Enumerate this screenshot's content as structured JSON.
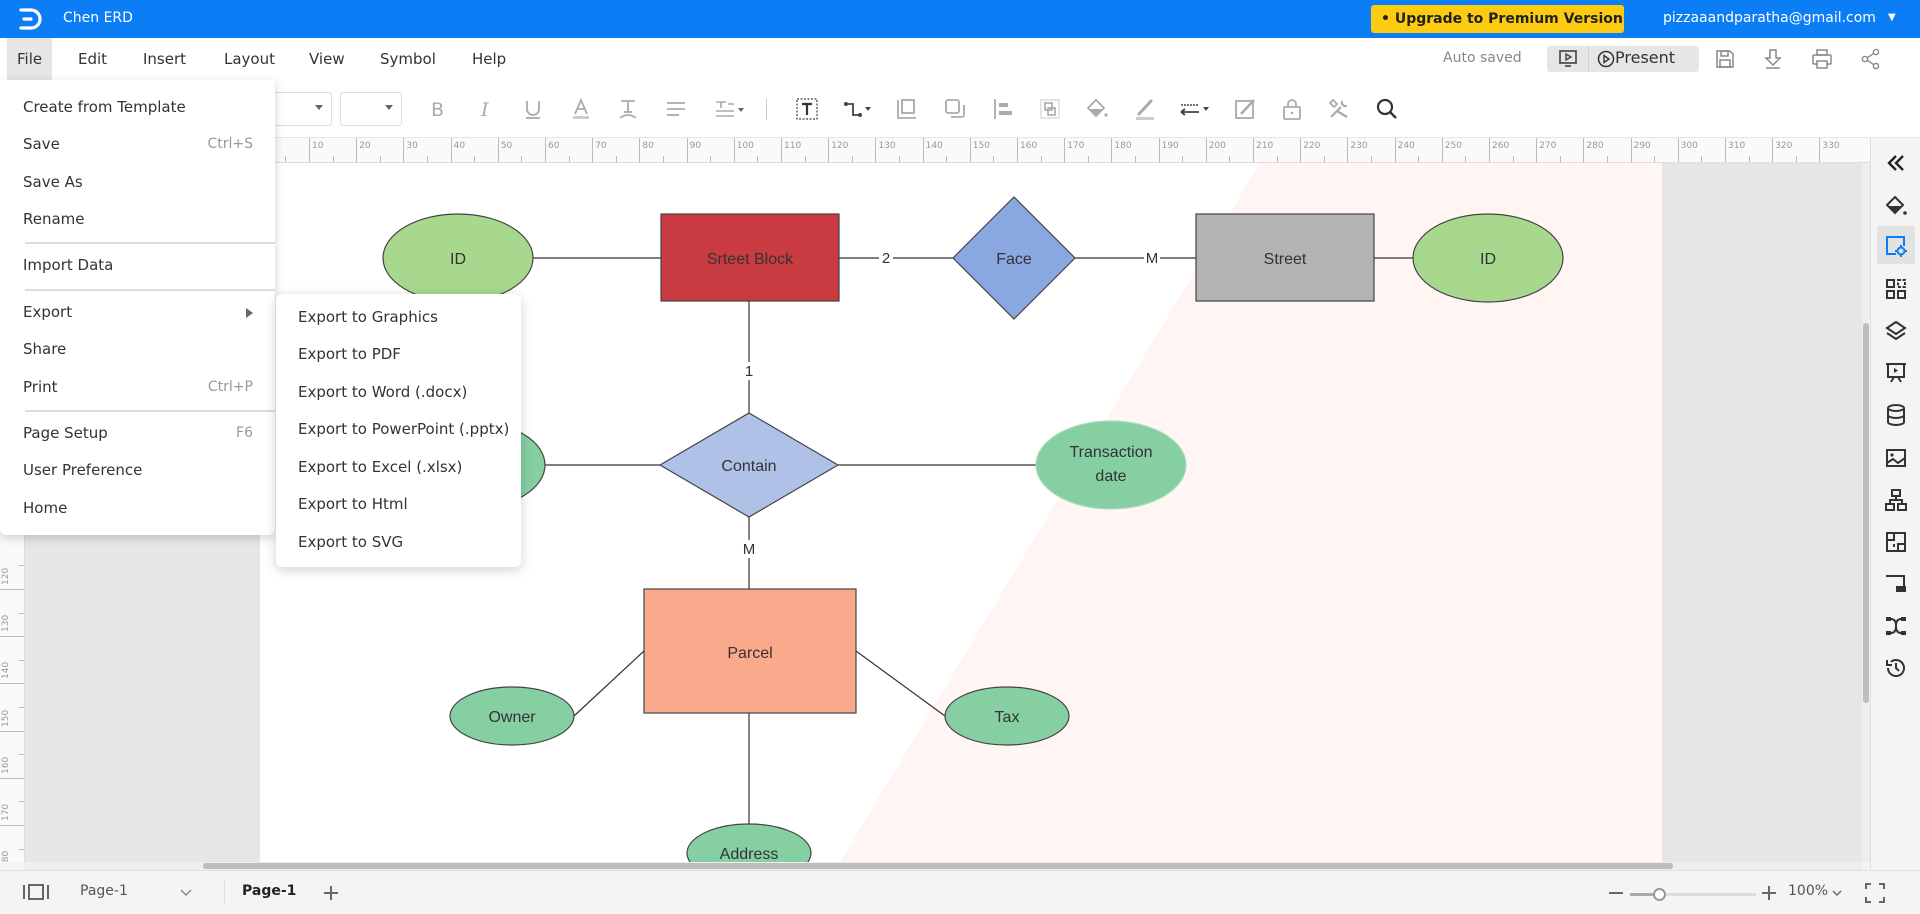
{
  "app": {
    "title": "Chen ERD",
    "upgrade_label": "• Upgrade to Premium Version",
    "user_email": "pizzaaandparatha@gmail.com"
  },
  "menubar": {
    "items": [
      "File",
      "Edit",
      "Insert",
      "Layout",
      "View",
      "Symbol",
      "Help"
    ],
    "active": "File",
    "status": "Auto saved",
    "present_label": "Present"
  },
  "toolbar": {
    "font_family_value": "",
    "font_size_value": "",
    "icons": [
      "bold-icon",
      "italic-icon",
      "underline-icon",
      "font-color-icon",
      "text-style-icon",
      "align-icon",
      "spacing-icon",
      "text-box-icon",
      "connector-icon",
      "container-icon",
      "arrange-icon",
      "align-shapes-icon",
      "group-icon",
      "fill-icon",
      "line-color-icon",
      "line-style-icon",
      "edit-image-icon",
      "lock-icon",
      "tools-icon",
      "search-icon"
    ]
  },
  "ruler": {
    "horizontal": [
      "10",
      "20",
      "30",
      "40",
      "50",
      "60",
      "70",
      "80",
      "90",
      "100",
      "110",
      "120",
      "130",
      "140",
      "150",
      "160",
      "170",
      "180",
      "190",
      "200",
      "210",
      "220",
      "230",
      "240",
      "250",
      "260",
      "270",
      "280",
      "290",
      "300",
      "310",
      "320",
      "330"
    ],
    "vertical": [
      "120",
      "130",
      "140",
      "150",
      "160",
      "170",
      "180"
    ]
  },
  "file_menu": {
    "items": [
      {
        "label": "Create from Template",
        "shortcut": ""
      },
      {
        "label": "Save",
        "shortcut": "Ctrl+S"
      },
      {
        "label": "Save As",
        "shortcut": ""
      },
      {
        "label": "Rename",
        "shortcut": ""
      },
      {
        "label": "Import Data",
        "shortcut": ""
      },
      {
        "label": "Export",
        "shortcut": "",
        "submenu": true
      },
      {
        "label": "Share",
        "shortcut": ""
      },
      {
        "label": "Print",
        "shortcut": "Ctrl+P"
      },
      {
        "label": "Page Setup",
        "shortcut": "F6"
      },
      {
        "label": "User Preference",
        "shortcut": ""
      },
      {
        "label": "Home",
        "shortcut": ""
      }
    ]
  },
  "export_menu": {
    "items": [
      "Export to Graphics",
      "Export to PDF",
      "Export to Word (.docx)",
      "Export to PowerPoint (.pptx)",
      "Export to Excel (.xlsx)",
      "Export to Html",
      "Export to SVG"
    ]
  },
  "diagram": {
    "entities": [
      {
        "id": "street-block",
        "label": "Srteet Block",
        "color": "#c93b40"
      },
      {
        "id": "street",
        "label": "Street",
        "color": "#b3b3b3"
      },
      {
        "id": "parcel",
        "label": "Parcel",
        "color": "#fba98d"
      }
    ],
    "relationships": [
      {
        "id": "face",
        "label": "Face",
        "color": "#8aa7e0"
      },
      {
        "id": "contain",
        "label": "Contain",
        "color": "#b0c1e8"
      }
    ],
    "attributes": [
      {
        "id": "id-left",
        "label": "ID",
        "color": "#a8d88e"
      },
      {
        "id": "id-right",
        "label": "ID",
        "color": "#a8d88e"
      },
      {
        "id": "hidden-attr",
        "label": "",
        "color": "#86cfa3"
      },
      {
        "id": "transaction-date",
        "label": "Transaction date",
        "lines": [
          "Transaction",
          "date"
        ],
        "color": "#86cfa3"
      },
      {
        "id": "owner",
        "label": "Owner",
        "color": "#86cfa3"
      },
      {
        "id": "tax",
        "label": "Tax",
        "color": "#86cfa3"
      },
      {
        "id": "address",
        "label": "Address",
        "color": "#86cfa3"
      }
    ],
    "cardinalities": [
      {
        "between": "street-block/face",
        "label": "2"
      },
      {
        "between": "face/street",
        "label": "M"
      },
      {
        "between": "street-block/contain",
        "label": "1"
      },
      {
        "between": "contain/parcel",
        "label": "M"
      }
    ]
  },
  "bottombar": {
    "page_select": "Page-1",
    "page_tab": "Page-1",
    "zoom_level": "100%",
    "zoom_fraction": 0.23
  },
  "colors": {
    "brand": "#0b7ef5",
    "upgrade": "#fdcb10",
    "sidebar_active": "#0b7ef5"
  }
}
